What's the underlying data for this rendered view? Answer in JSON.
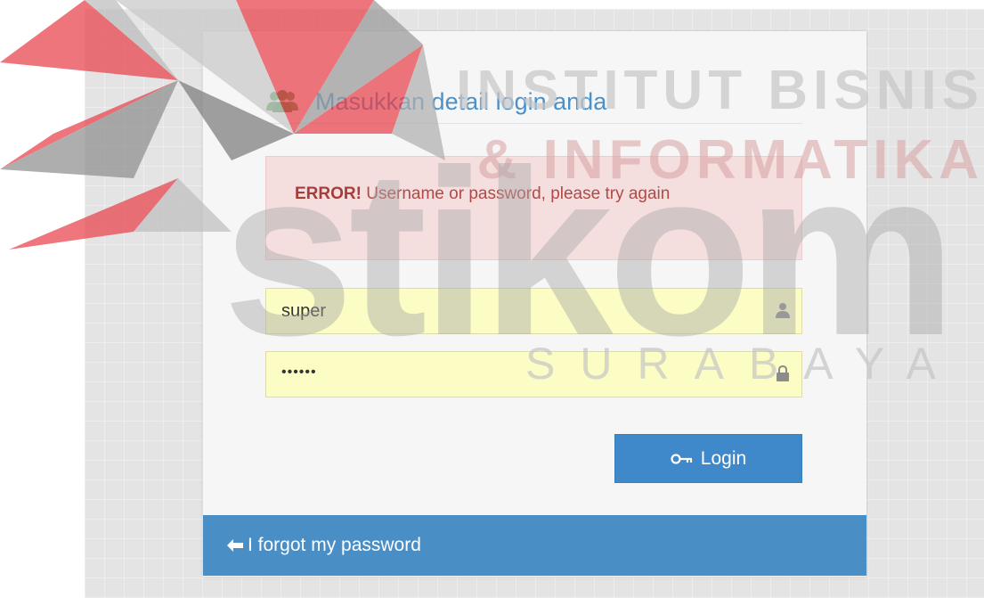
{
  "login": {
    "heading": "Masukkan detail login anda",
    "error_strong": "ERROR!",
    "error_message": "Username or password, please try again",
    "username_value": "super",
    "password_value": "••••••",
    "login_button": "Login",
    "forgot_link": "I forgot my password"
  },
  "watermark": {
    "line1": "INSTITUT BISNIS",
    "line2": "& INFORMATIKA",
    "main": "stikom",
    "city": "SURABAYA"
  },
  "icons": {
    "heading": "users-icon",
    "username": "user-icon",
    "password": "lock-icon",
    "login": "key-icon",
    "forgot": "arrow-left-icon"
  },
  "colors": {
    "accent": "#4a8ec6",
    "error_bg": "#f4dede",
    "error_text": "#b04a48",
    "input_bg": "#fbfdc4",
    "logo_red": "#e8414a"
  }
}
